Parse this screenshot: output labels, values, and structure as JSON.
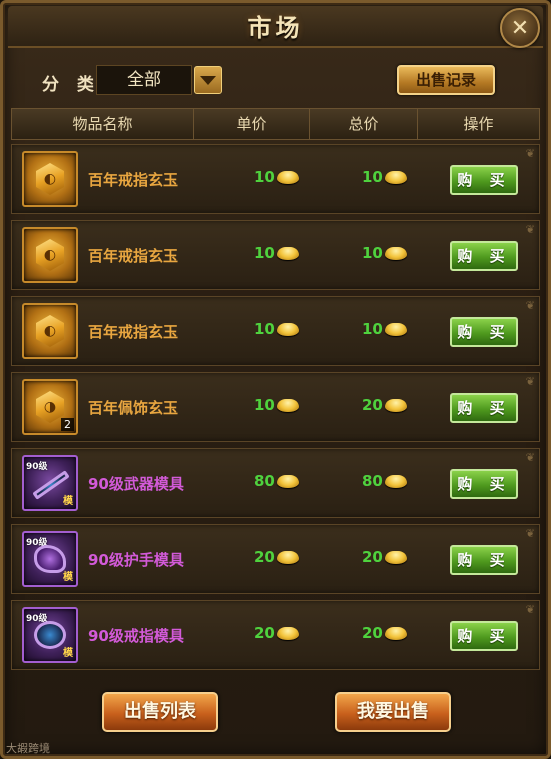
{
  "window": {
    "title": "市场"
  },
  "filter": {
    "label": "分 类",
    "selected": "全部",
    "sell_record_label": "出售记录"
  },
  "table": {
    "headers": [
      "物品名称",
      "单价",
      "总价",
      "操作"
    ],
    "rows": [
      {
        "name": "百年戒指玄玉",
        "unit_price": "10",
        "total_price": "10",
        "action": "购 买",
        "icon": "gold-jade-icon",
        "quantity": ""
      },
      {
        "name": "百年戒指玄玉",
        "unit_price": "10",
        "total_price": "10",
        "action": "购 买",
        "icon": "gold-jade-icon",
        "quantity": ""
      },
      {
        "name": "百年戒指玄玉",
        "unit_price": "10",
        "total_price": "10",
        "action": "购 买",
        "icon": "gold-jade-icon",
        "quantity": ""
      },
      {
        "name": "百年佩饰玄玉",
        "unit_price": "10",
        "total_price": "20",
        "action": "购 买",
        "icon": "gold-pendant-jade-icon",
        "quantity": "2"
      },
      {
        "name": "90级武器模具",
        "unit_price": "80",
        "total_price": "80",
        "action": "购 买",
        "icon": "weapon-mold-icon",
        "quantity": ""
      },
      {
        "name": "90级护手模具",
        "unit_price": "20",
        "total_price": "20",
        "action": "购 买",
        "icon": "gauntlet-mold-icon",
        "quantity": ""
      },
      {
        "name": "90级戒指模具",
        "unit_price": "20",
        "total_price": "20",
        "action": "购 买",
        "icon": "ring-mold-icon",
        "quantity": ""
      }
    ]
  },
  "icon_labels": {
    "level": "90级",
    "mold": "模"
  },
  "bottom": {
    "sell_list_label": "出售列表",
    "want_sell_label": "我要出售"
  },
  "watermark": "大嘏跨境",
  "colors": {
    "gold_item": "#e8a640",
    "purple_item": "#d25ad8",
    "price_green": "#4fd23e",
    "buy_green": "#4f9a1e",
    "orange_button": "#c8601c"
  }
}
